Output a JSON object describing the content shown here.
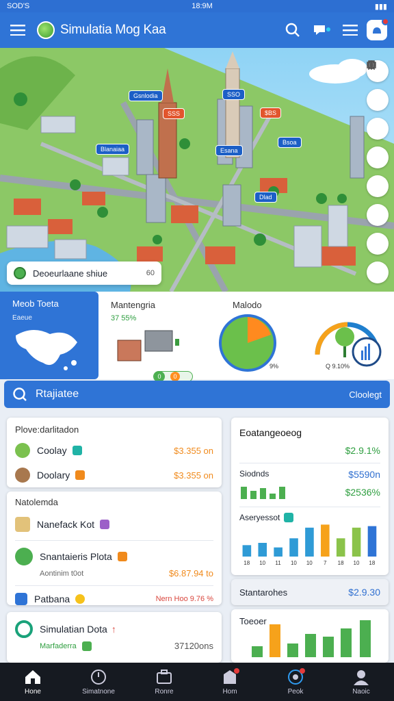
{
  "status": {
    "left": "SOD'S",
    "time": "18:9M"
  },
  "header": {
    "title": "Simulatia Mog Kaa"
  },
  "map": {
    "tags": [
      "Gsnlodia",
      "SSO",
      "Blanaiaa",
      "SSS",
      "$BS",
      "Esana",
      "Bsoa",
      "Dlad"
    ],
    "location_card": {
      "text": "Deoeurlaane shiue",
      "value": "60"
    }
  },
  "stats": {
    "blue": {
      "title": "Meob Toeta",
      "sub": "Eaeue"
    },
    "mgmt": {
      "label": "Mantengria",
      "pct": "37 55%"
    },
    "modo": {
      "label": "Malodo",
      "value": "9%"
    },
    "growth": {
      "label": "Q 9.10%"
    }
  },
  "search": {
    "label": "Rtajiatee",
    "right": "Cloolegt"
  },
  "left_card": {
    "title": "Plove:darlitadon",
    "rows": [
      {
        "label": "Coolay",
        "amount": "$3.355 on"
      },
      {
        "label": "Doolary",
        "amount": "$3.355 on"
      }
    ]
  },
  "left_card2": {
    "title": "Natolemda",
    "row": {
      "label": "Nanefack Kot"
    },
    "block_title": "Snantaieris Plota",
    "block_sub": "Aontinim t0ot",
    "block_value": "$6.87.94 to",
    "bottom_label": "Patbana",
    "bottom_value": "Nern Hoo 9.76 %"
  },
  "left_card3": {
    "title": "Simulatian Dota",
    "sub": "Marfaderra",
    "value": "37120ons"
  },
  "right_card": {
    "title": "Eoatangeoeog",
    "top_value": "$2.9.1%",
    "sub_label": "Siodnds",
    "sub_value1": "$5590n",
    "sub_value2": "$2536%",
    "chart_title": "Aseryessot",
    "chart_ticks": [
      "18",
      "10",
      "11",
      "10",
      "10",
      "7",
      "18",
      "10",
      "18"
    ]
  },
  "right_card2": {
    "label": "Stantarohes",
    "value": "$2.9.30"
  },
  "right_card3": {
    "title": "Toeoer"
  },
  "nav": [
    "Hone",
    "Simatnone",
    "Ronre",
    "Hom",
    "Peok",
    "Naoic"
  ],
  "chart_data": [
    {
      "type": "bar",
      "categories": [
        "18",
        "10",
        "11",
        "10",
        "10",
        "7",
        "18",
        "10",
        "18"
      ],
      "series": [
        {
          "values": [
            15,
            18,
            12,
            24,
            38,
            42,
            24,
            38,
            40
          ]
        }
      ],
      "title": "Aseryessot",
      "xlabel": "",
      "ylabel": "",
      "ylim": [
        0,
        45
      ]
    }
  ]
}
